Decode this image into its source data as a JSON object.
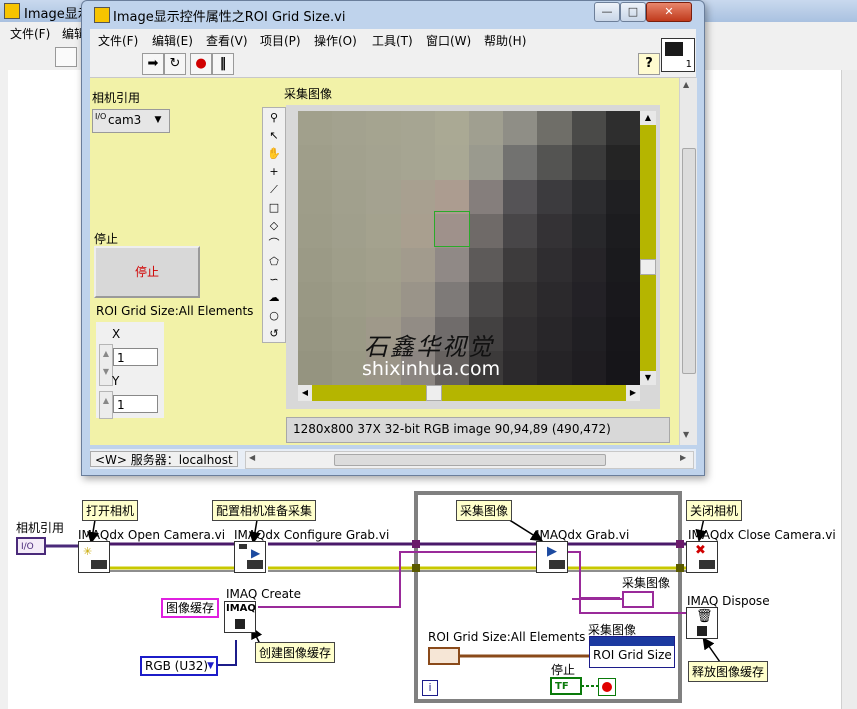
{
  "bg_window": {
    "title": "Image显示",
    "menu": [
      "文件(F)",
      "编辑"
    ]
  },
  "front_panel": {
    "title": "Image显示控件属性之ROI Grid Size.vi",
    "window_buttons": [
      "—",
      "□",
      "✕"
    ],
    "menu": [
      "文件(F)",
      "编辑(E)",
      "查看(V)",
      "项目(P)",
      "操作(O)",
      "工具(T)",
      "窗口(W)",
      "帮助(H)"
    ],
    "toolbar": {
      "run": "➡",
      "run_continuous": "↻",
      "abort": "●",
      "pause": "‖",
      "help": "?"
    },
    "connector_badge": "1",
    "camera": {
      "label": "相机引用",
      "io_glyph": "I/O",
      "value": "cam3"
    },
    "stop": {
      "label": "停止",
      "button_text": "停止"
    },
    "roi": {
      "label": "ROI Grid Size:All Elements",
      "x_label": "X",
      "x_value": "1",
      "y_label": "Y",
      "y_value": "1"
    },
    "image": {
      "label": "采集图像",
      "info": "1280x800 37X 32-bit RGB image 90,94,89     (490,472)",
      "watermark_cn": "石鑫华视觉",
      "watermark_url": "shixinhua.com",
      "pixel_grid": [
        [
          "#a1a08c",
          "#a3a28f",
          "#a5a490",
          "#a6a592",
          "#aaa994",
          "#a09f90",
          "#8f8e86",
          "#6f6e68",
          "#4a4a48",
          "#2e2e2e"
        ],
        [
          "#9f9e8a",
          "#a2a18e",
          "#a4a390",
          "#a6a592",
          "#a9a894",
          "#9a9a8e",
          "#727270",
          "#545452",
          "#3a3a3a",
          "#242424"
        ],
        [
          "#9e9d89",
          "#a1a08d",
          "#a4a290",
          "#a8a090",
          "#ac9c90",
          "#857e7c",
          "#555356",
          "#3c3b3e",
          "#2d2d30",
          "#1f1f22"
        ],
        [
          "#9d9c88",
          "#a09f8c",
          "#a4a28e",
          "#a99f8f",
          "#9f918b",
          "#6f6a68",
          "#484648",
          "#343235",
          "#28282b",
          "#1c1c1f"
        ],
        [
          "#9b9a86",
          "#9f9e8a",
          "#a2a08c",
          "#a29b8d",
          "#908986",
          "#5d5a59",
          "#3d3b3c",
          "#2f2d30",
          "#262428",
          "#1a1a1d"
        ],
        [
          "#999884",
          "#9d9c88",
          "#a09d8a",
          "#9a9489",
          "#7e7a78",
          "#4d4b4b",
          "#353334",
          "#2b292c",
          "#232126",
          "#19181c"
        ],
        [
          "#979682",
          "#9b9a86",
          "#9f998a",
          "#928c85",
          "#706c6b",
          "#434141",
          "#302e30",
          "#282629",
          "#201f23",
          "#17161a"
        ],
        [
          "#959480",
          "#999884",
          "#9b9587",
          "#8b8581",
          "#66615f",
          "#3c3a3a",
          "#2c2a2c",
          "#252326",
          "#1f1d21",
          "#161519"
        ]
      ]
    },
    "status": "<W> 服务器：localhost"
  },
  "block_diagram": {
    "cam_control_label": "相机引用",
    "cam_control_glyph": "I/O",
    "comments": {
      "open": "打开相机",
      "configure": "配置相机准备采集",
      "grab": "采集图像",
      "close": "关闭相机",
      "create": "创建图像缓存",
      "dispose": "释放图像缓存"
    },
    "vis": {
      "open": "IMAQdx Open Camera.vi",
      "configure": "IMAQdx Configure Grab.vi",
      "grab": "IMAQdx Grab.vi",
      "close": "IMAQdx Close Camera.vi",
      "create": "IMAQ Create",
      "create_icon": "IMAQ",
      "dispose": "IMAQ Dispose"
    },
    "constants": {
      "buffer_name": "图像缓存",
      "image_type": "RGB (U32)"
    },
    "loop": {
      "roi_label": "ROI Grid Size:All Elements",
      "node_label": "采集图像",
      "property": "ROI Grid Size",
      "image_indicator_label": "采集图像",
      "stop_label": "停止",
      "stop_terminal": "TF",
      "iteration": "i"
    }
  },
  "colors": {
    "panel_bg": "#f2f2a8",
    "image_wire": "#7a1f7a",
    "error_wire": "#d4d400",
    "refnum_wire": "#1c1c8a",
    "cluster_wire": "#7a3a00",
    "bool_wire": "#0a7a0a"
  }
}
